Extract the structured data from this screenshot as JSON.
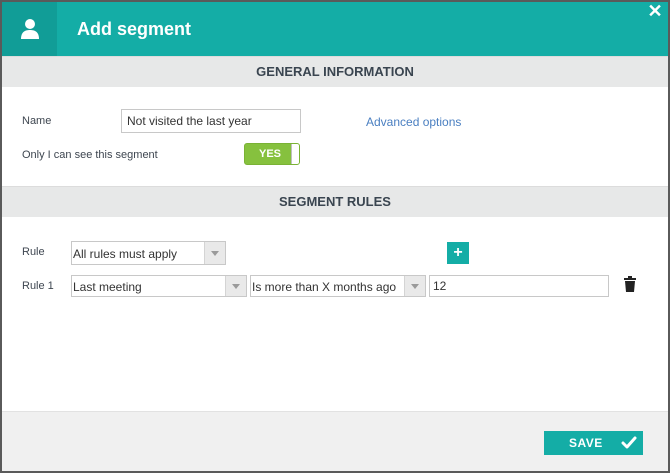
{
  "dialog": {
    "title": "Add segment",
    "header_icon": "user-icon",
    "close_icon": "close-icon"
  },
  "general": {
    "section_title": "GENERAL INFORMATION",
    "name_label": "Name",
    "name_value": "Not visited the last year",
    "advanced_link": "Advanced options",
    "visibility_label": "Only I can see this segment",
    "visibility_toggle": "YES"
  },
  "rules": {
    "section_title": "SEGMENT RULES",
    "rule_label": "Rule",
    "rule_mode": "All rules must apply",
    "add_icon": "plus-icon",
    "items": [
      {
        "label": "Rule 1",
        "field": "Last meeting",
        "condition": "Is more than X months ago",
        "value": "12",
        "delete_icon": "trash-icon"
      }
    ]
  },
  "footer": {
    "save_label": "SAVE",
    "save_icon": "checkmark-icon"
  },
  "colors": {
    "brand": "#14ada6",
    "toggle_on": "#86c13e",
    "link": "#4a7fc1"
  }
}
